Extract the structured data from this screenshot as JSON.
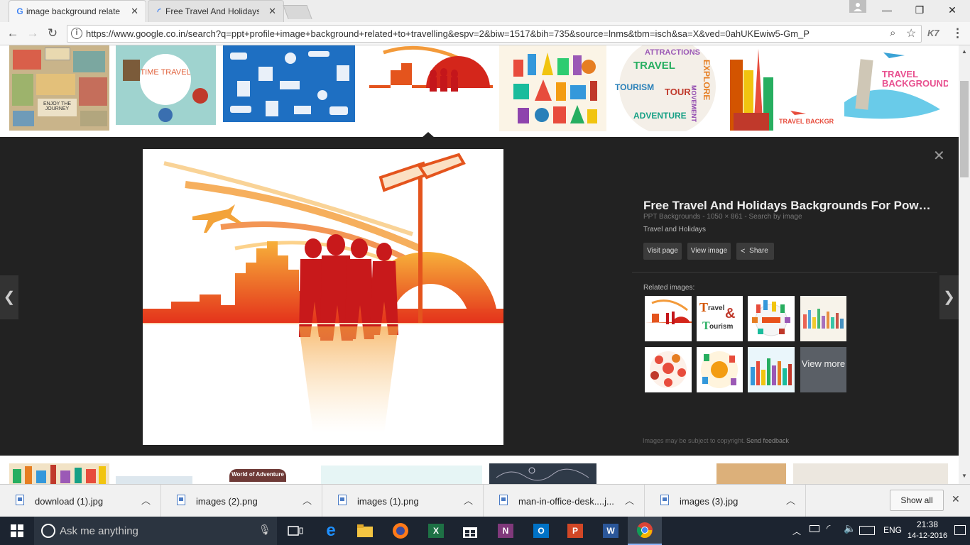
{
  "browser": {
    "tabs": [
      {
        "title": "image background relate",
        "close": "✕"
      },
      {
        "title": "Free Travel And Holidays",
        "close": "✕"
      }
    ],
    "window_controls": {
      "minimize": "—",
      "restore": "❐",
      "close": "✕"
    },
    "url": "https://www.google.co.in/search?q=ppt+profile+image+background+related+to+travelling&espv=2&biw=1517&bih=735&source=lnms&tbm=isch&sa=X&ved=0ahUKEwiw5-Gm_P",
    "extension_label": "K7"
  },
  "top_thumbs": {
    "t1_text": "ENJOY THE JOURNEY",
    "t2_text": "TIME TRAVEL",
    "t6_words": [
      "ATTRACTIONS",
      "TRAVEL",
      "TOURISM",
      "EXPLORE",
      "TOUR",
      "ADVENTURE",
      "MOVEMENT"
    ],
    "t7_text": "TRAVEL BACKGROUND",
    "t8_text": "TRAVEL BACKGROUND"
  },
  "preview": {
    "title": "Free Travel And Holidays Backgrounds For Pow…",
    "meta": "PPT Backgrounds - 1050 × 861 - Search by image",
    "subtitle": "Travel and Holidays",
    "buttons": {
      "visit": "Visit page",
      "view": "View image",
      "share": "Share"
    },
    "related_label": "Related images:",
    "view_more": "View more",
    "footer_copyright": "Images may be subject to copyright.",
    "footer_feedback": "Send feedback",
    "close": "✕",
    "prev": "❮",
    "next": "❯"
  },
  "bottom_thumbs": {
    "t3_text": "World of Adventure"
  },
  "downloads": {
    "items": [
      {
        "name": "download (1).jpg"
      },
      {
        "name": "images (2).png"
      },
      {
        "name": "images (1).png"
      },
      {
        "name": "man-in-office-desk....j..."
      },
      {
        "name": "images (3).jpg"
      }
    ],
    "show_all": "Show all",
    "close": "✕"
  },
  "taskbar": {
    "search_placeholder": "Ask me anything",
    "language": "ENG",
    "time": "21:38",
    "date": "14-12-2016"
  },
  "colors": {
    "accent_orange": "#e8501a",
    "panel_bg": "#222222",
    "taskbar_bg": "#1c2430"
  }
}
